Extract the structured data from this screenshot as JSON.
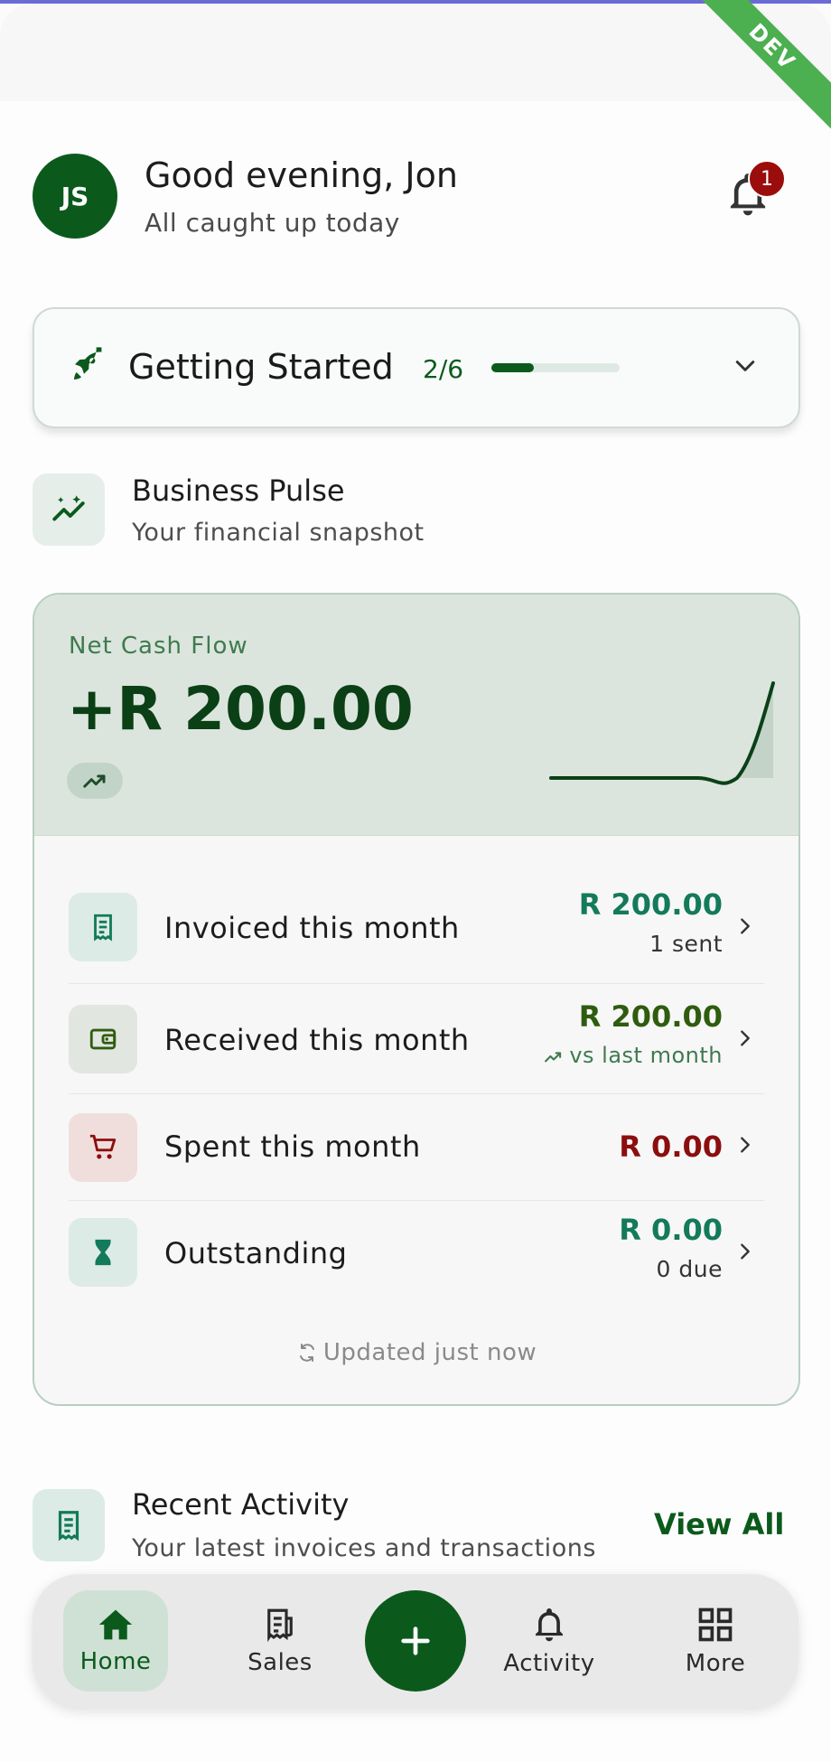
{
  "ribbon": {
    "label": "DEV"
  },
  "header": {
    "avatar_initials": "JS",
    "greeting": "Good evening, Jon",
    "subtitle": "All caught up today",
    "notification_count": "1"
  },
  "getting_started": {
    "title": "Getting Started",
    "progress_text": "2/6",
    "progress_fraction": 0.333
  },
  "business_pulse": {
    "title": "Business Pulse",
    "subtitle": "Your financial snapshot"
  },
  "net_cash_flow": {
    "label": "Net Cash Flow",
    "value": "+R 200.00"
  },
  "pulse_rows": [
    {
      "label": "Invoiced this month",
      "amount": "R 200.00",
      "sub": "1 sent",
      "color": "#137a5a"
    },
    {
      "label": "Received this month",
      "amount": "R 200.00",
      "sub": "vs last month",
      "color": "#2f5c0f"
    },
    {
      "label": "Spent this month",
      "amount": "R 0.00",
      "sub": "",
      "color": "#8b0e0e"
    },
    {
      "label": "Outstanding",
      "amount": "R 0.00",
      "sub": "0 due",
      "color": "#137a5a"
    }
  ],
  "updated_text": "Updated just now",
  "recent_activity": {
    "title": "Recent Activity",
    "subtitle": "Your latest invoices and transactions",
    "view_all": "View All"
  },
  "nav": {
    "home": "Home",
    "sales": "Sales",
    "activity": "Activity",
    "more": "More"
  },
  "colors": {
    "brand": "#0b5a1c",
    "accent_light": "#dbe5dd",
    "danger": "#8b0e0e"
  }
}
